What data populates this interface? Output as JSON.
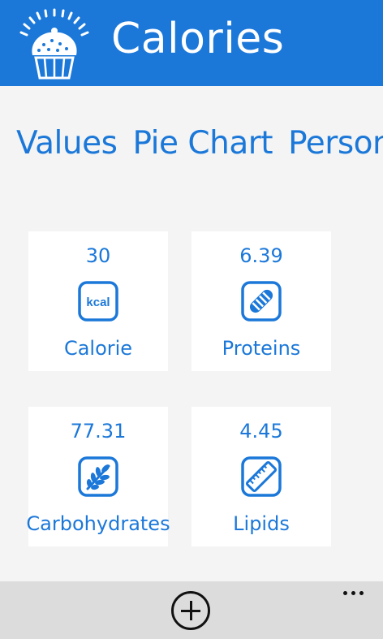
{
  "header": {
    "title": "Calories",
    "logo_icon": "muffin-gauge-icon"
  },
  "pivot": {
    "items": [
      "Values",
      "Pie Chart",
      "Personal"
    ]
  },
  "tiles": [
    {
      "value": "30",
      "label": "Calorie",
      "icon": "kcal-icon",
      "icon_text": "kcal"
    },
    {
      "value": "6.39",
      "label": "Proteins",
      "icon": "protein-icon"
    },
    {
      "value": "77.31",
      "label": "Carbohydrates",
      "icon": "wheat-icon"
    },
    {
      "value": "4.45",
      "label": "Lipids",
      "icon": "ruler-icon"
    }
  ],
  "colors": {
    "accent": "#1b78d9",
    "background": "#f4f4f4",
    "tile": "#ffffff",
    "appbar": "#dcdcdc"
  },
  "appbar": {
    "add_icon": "add-circle-icon",
    "more_icon": "more-icon"
  }
}
